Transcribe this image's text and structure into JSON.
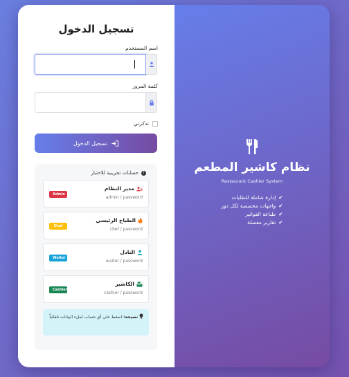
{
  "login": {
    "title": "تسجيل الدخول",
    "username_label": "اسم المستخدم",
    "username_value": "",
    "password_label": "كلمة المرور",
    "password_value": "",
    "remember_label": "تذكرني",
    "submit_label": "تسجيل الدخول"
  },
  "demo": {
    "title": "حسابات تجريبية للاختبار",
    "accounts": [
      {
        "name": "مدير النظام",
        "credentials": "admin / password",
        "badge": "Admin",
        "badge_color": "#dc3545",
        "icon": "users-cog-icon",
        "icon_color": "#dc3545"
      },
      {
        "name": "الطباخ الرئيسي",
        "credentials": "chef / password",
        "badge": "Chef",
        "badge_color": "#ffc107",
        "icon": "fire-icon",
        "icon_color": "#fd7e14"
      },
      {
        "name": "النادل",
        "credentials": "waiter / password",
        "badge": "Waiter",
        "badge_color": "#17a2d8",
        "icon": "user-icon",
        "icon_color": "#17a2b8"
      },
      {
        "name": "الكاشير",
        "credentials": "cashier / password",
        "badge": "Cashier",
        "badge_color": "#198754",
        "icon": "cash-register-icon",
        "icon_color": "#198754"
      }
    ],
    "tip_bold": "نصيحة:",
    "tip_text": "اضغط على أي حساب لملء البيانات تلقائياً"
  },
  "brand": {
    "icon": "utensils-icon",
    "title": "نظام كاشير المطعم",
    "subtitle": "Restaurant Cashier System",
    "features": [
      "إدارة شاملة للطلبات",
      "واجهات مخصصة لكل دور",
      "طباعة الفواتير",
      "تقارير مفصلة"
    ]
  },
  "colors": {
    "gradient_start": "#667eea",
    "gradient_end": "#764ba2"
  }
}
